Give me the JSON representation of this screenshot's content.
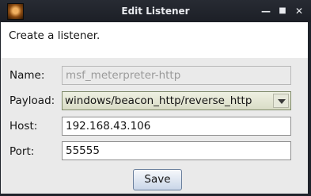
{
  "window": {
    "title": "Edit Listener",
    "controls": {
      "minimize": "—",
      "maximize": "■",
      "close": "✕"
    }
  },
  "banner": {
    "text": "Create a listener."
  },
  "form": {
    "name": {
      "label": "Name:",
      "value": "msf_meterpreter-http"
    },
    "payload": {
      "label": "Payload:",
      "value": "windows/beacon_http/reverse_http"
    },
    "host": {
      "label": "Host:",
      "value": "192.168.43.106"
    },
    "port": {
      "label": "Port:",
      "value": "55555"
    }
  },
  "actions": {
    "save": "Save"
  }
}
